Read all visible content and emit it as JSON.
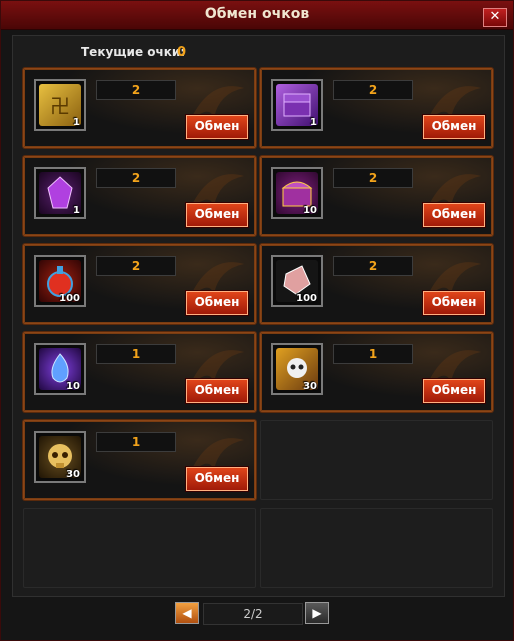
{
  "window": {
    "title": "Обмен очков",
    "close_label": "✕"
  },
  "points": {
    "label": "Текущие очки:",
    "value": "0"
  },
  "exchange_label": "Обмен",
  "items": [
    {
      "name": "rune-scroll",
      "cost": "2",
      "qty": "1"
    },
    {
      "name": "purple-chest",
      "cost": "2",
      "qty": "1"
    },
    {
      "name": "purple-crystal",
      "cost": "2",
      "qty": "1"
    },
    {
      "name": "purple-treasure-chest",
      "cost": "2",
      "qty": "10"
    },
    {
      "name": "fire-potion",
      "cost": "2",
      "qty": "100"
    },
    {
      "name": "gem-stone",
      "cost": "2",
      "qty": "100"
    },
    {
      "name": "blue-flame",
      "cost": "1",
      "qty": "10"
    },
    {
      "name": "skull-box",
      "cost": "1",
      "qty": "30"
    },
    {
      "name": "golden-skull",
      "cost": "1",
      "qty": "30"
    }
  ],
  "pager": {
    "text": "2/2",
    "prev_label": "◀",
    "next_label": "▶"
  }
}
